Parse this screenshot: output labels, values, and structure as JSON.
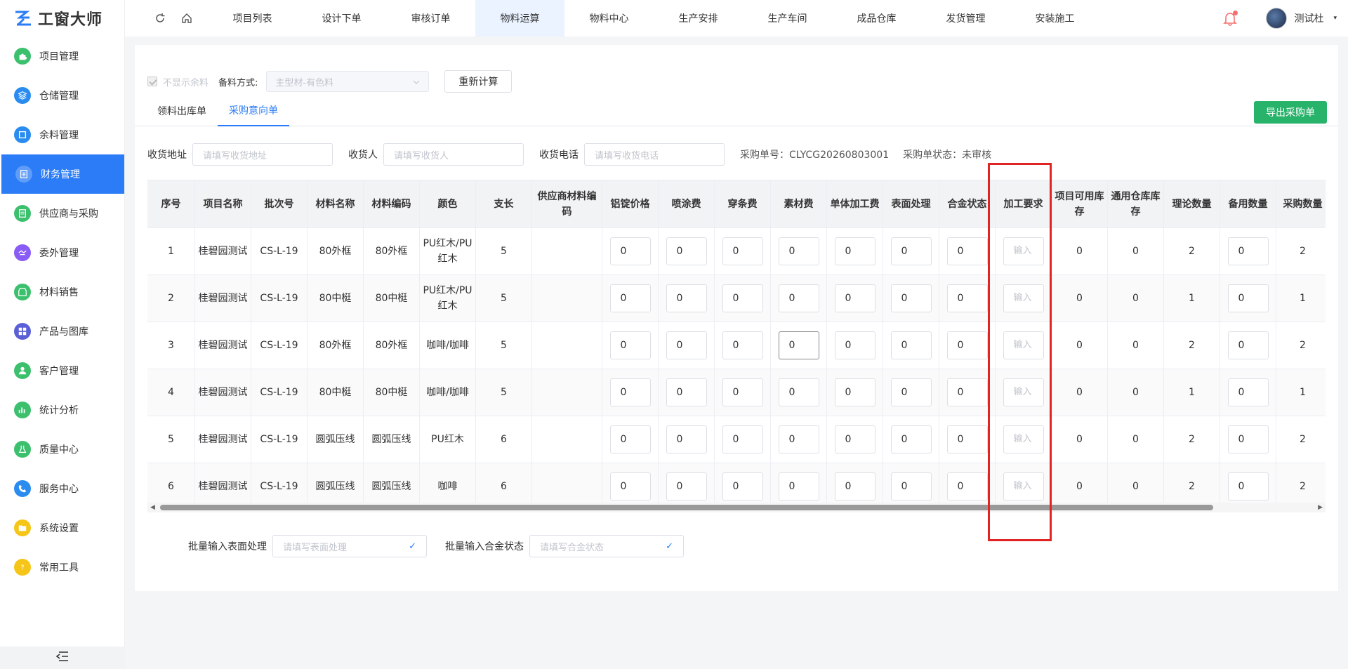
{
  "app": {
    "name": "工窗大师"
  },
  "sidebar": {
    "items": [
      {
        "label": "项目管理",
        "icon": "puzzle-icon",
        "color": "#3cc06e"
      },
      {
        "label": "仓储管理",
        "icon": "layers-icon",
        "color": "#2b8cf0"
      },
      {
        "label": "余料管理",
        "icon": "box-icon",
        "color": "#2b8cf0"
      },
      {
        "label": "财务管理",
        "icon": "finance-icon",
        "color": "#2b7cf6"
      },
      {
        "label": "供应商与采购",
        "icon": "document-icon",
        "color": "#3cc06e"
      },
      {
        "label": "委外管理",
        "icon": "handshake-icon",
        "color": "#8a5cf6"
      },
      {
        "label": "材料销售",
        "icon": "store-icon",
        "color": "#3cc06e"
      },
      {
        "label": "产品与图库",
        "icon": "gallery-icon",
        "color": "#5b5fd6"
      },
      {
        "label": "客户管理",
        "icon": "user-icon",
        "color": "#3cc06e"
      },
      {
        "label": "统计分析",
        "icon": "chart-icon",
        "color": "#3cc06e"
      },
      {
        "label": "质量中心",
        "icon": "flask-icon",
        "color": "#3cc06e"
      },
      {
        "label": "服务中心",
        "icon": "phone-icon",
        "color": "#2b8cf0"
      },
      {
        "label": "系统设置",
        "icon": "folder-icon",
        "color": "#f5c518"
      },
      {
        "label": "常用工具",
        "icon": "help-icon",
        "color": "#f5c518"
      }
    ],
    "active": 3
  },
  "topnav": {
    "tabs": [
      "项目列表",
      "设计下单",
      "审核订单",
      "物料运算",
      "物料中心",
      "生产安排",
      "生产车间",
      "成品仓库",
      "发货管理",
      "安装施工"
    ],
    "active": 3
  },
  "user": {
    "name": "测试杜"
  },
  "options": {
    "hide_remnant": "不显示余料",
    "method_label": "备料方式:",
    "method_value": "主型材-有色料",
    "recalc": "重新计算"
  },
  "subtabs": {
    "items": [
      "领料出库单",
      "采购意向单"
    ],
    "active": 1
  },
  "export_button": "导出采购单",
  "form": {
    "address_label": "收货地址",
    "address_placeholder": "请填写收货地址",
    "receiver_label": "收货人",
    "receiver_placeholder": "请填写收货人",
    "phone_label": "收货电话",
    "phone_placeholder": "请填写收货电话",
    "order_no": "采购单号：CLYCG20260803001",
    "order_status": "采购单状态：未审核"
  },
  "table": {
    "headers": [
      "序号",
      "项目名称",
      "批次号",
      "材料名称",
      "材料编码",
      "颜色",
      "支长",
      "供应商材料编码",
      "铝锭价格",
      "喷涂费",
      "穿条费",
      "素材费",
      "单体加工费",
      "表面处理",
      "合金状态",
      "加工要求",
      "项目可用库存",
      "通用仓库库存",
      "理论数量",
      "备用数量",
      "采购数量"
    ],
    "input_placeholder": "输入",
    "rows": [
      {
        "no": "1",
        "project": "桂碧园测试",
        "batch": "CS-L-19",
        "name": "80外框",
        "code": "80外框",
        "color": "PU红木/PU红木",
        "length": "5",
        "supplier_code": "",
        "ingot": "0",
        "spray": "0",
        "strip": "0",
        "material": "0",
        "unit_proc": "0",
        "surface": "0",
        "alloy": "0",
        "proc_req": "",
        "proj_stock": "0",
        "gen_stock": "0",
        "theory": "2",
        "spare": "0",
        "purchase": "2"
      },
      {
        "no": "2",
        "project": "桂碧园测试",
        "batch": "CS-L-19",
        "name": "80中梃",
        "code": "80中梃",
        "color": "PU红木/PU红木",
        "length": "5",
        "supplier_code": "",
        "ingot": "0",
        "spray": "0",
        "strip": "0",
        "material": "0",
        "unit_proc": "0",
        "surface": "0",
        "alloy": "0",
        "proc_req": "",
        "proj_stock": "0",
        "gen_stock": "0",
        "theory": "1",
        "spare": "0",
        "purchase": "1"
      },
      {
        "no": "3",
        "project": "桂碧园测试",
        "batch": "CS-L-19",
        "name": "80外框",
        "code": "80外框",
        "color": "咖啡/咖啡",
        "length": "5",
        "supplier_code": "",
        "ingot": "0",
        "spray": "0",
        "strip": "0",
        "material": "0",
        "unit_proc": "0",
        "surface": "0",
        "alloy": "0",
        "proc_req": "",
        "proj_stock": "0",
        "gen_stock": "0",
        "theory": "2",
        "spare": "0",
        "purchase": "2"
      },
      {
        "no": "4",
        "project": "桂碧园测试",
        "batch": "CS-L-19",
        "name": "80中梃",
        "code": "80中梃",
        "color": "咖啡/咖啡",
        "length": "5",
        "supplier_code": "",
        "ingot": "0",
        "spray": "0",
        "strip": "0",
        "material": "0",
        "unit_proc": "0",
        "surface": "0",
        "alloy": "0",
        "proc_req": "",
        "proj_stock": "0",
        "gen_stock": "0",
        "theory": "1",
        "spare": "0",
        "purchase": "1"
      },
      {
        "no": "5",
        "project": "桂碧园测试",
        "batch": "CS-L-19",
        "name": "圆弧压线",
        "code": "圆弧压线",
        "color": "PU红木",
        "length": "6",
        "supplier_code": "",
        "ingot": "0",
        "spray": "0",
        "strip": "0",
        "material": "0",
        "unit_proc": "0",
        "surface": "0",
        "alloy": "0",
        "proc_req": "",
        "proj_stock": "0",
        "gen_stock": "0",
        "theory": "2",
        "spare": "0",
        "purchase": "2"
      },
      {
        "no": "6",
        "project": "桂碧园测试",
        "batch": "CS-L-19",
        "name": "圆弧压线",
        "code": "圆弧压线",
        "color": "咖啡",
        "length": "6",
        "supplier_code": "",
        "ingot": "0",
        "spray": "0",
        "strip": "0",
        "material": "0",
        "unit_proc": "0",
        "surface": "0",
        "alloy": "0",
        "proc_req": "",
        "proj_stock": "0",
        "gen_stock": "0",
        "theory": "2",
        "spare": "0",
        "purchase": "2"
      }
    ]
  },
  "batch": {
    "surface_label": "批量输入表面处理",
    "surface_placeholder": "请填写表面处理",
    "alloy_label": "批量输入合金状态",
    "alloy_placeholder": "请填写合金状态"
  }
}
